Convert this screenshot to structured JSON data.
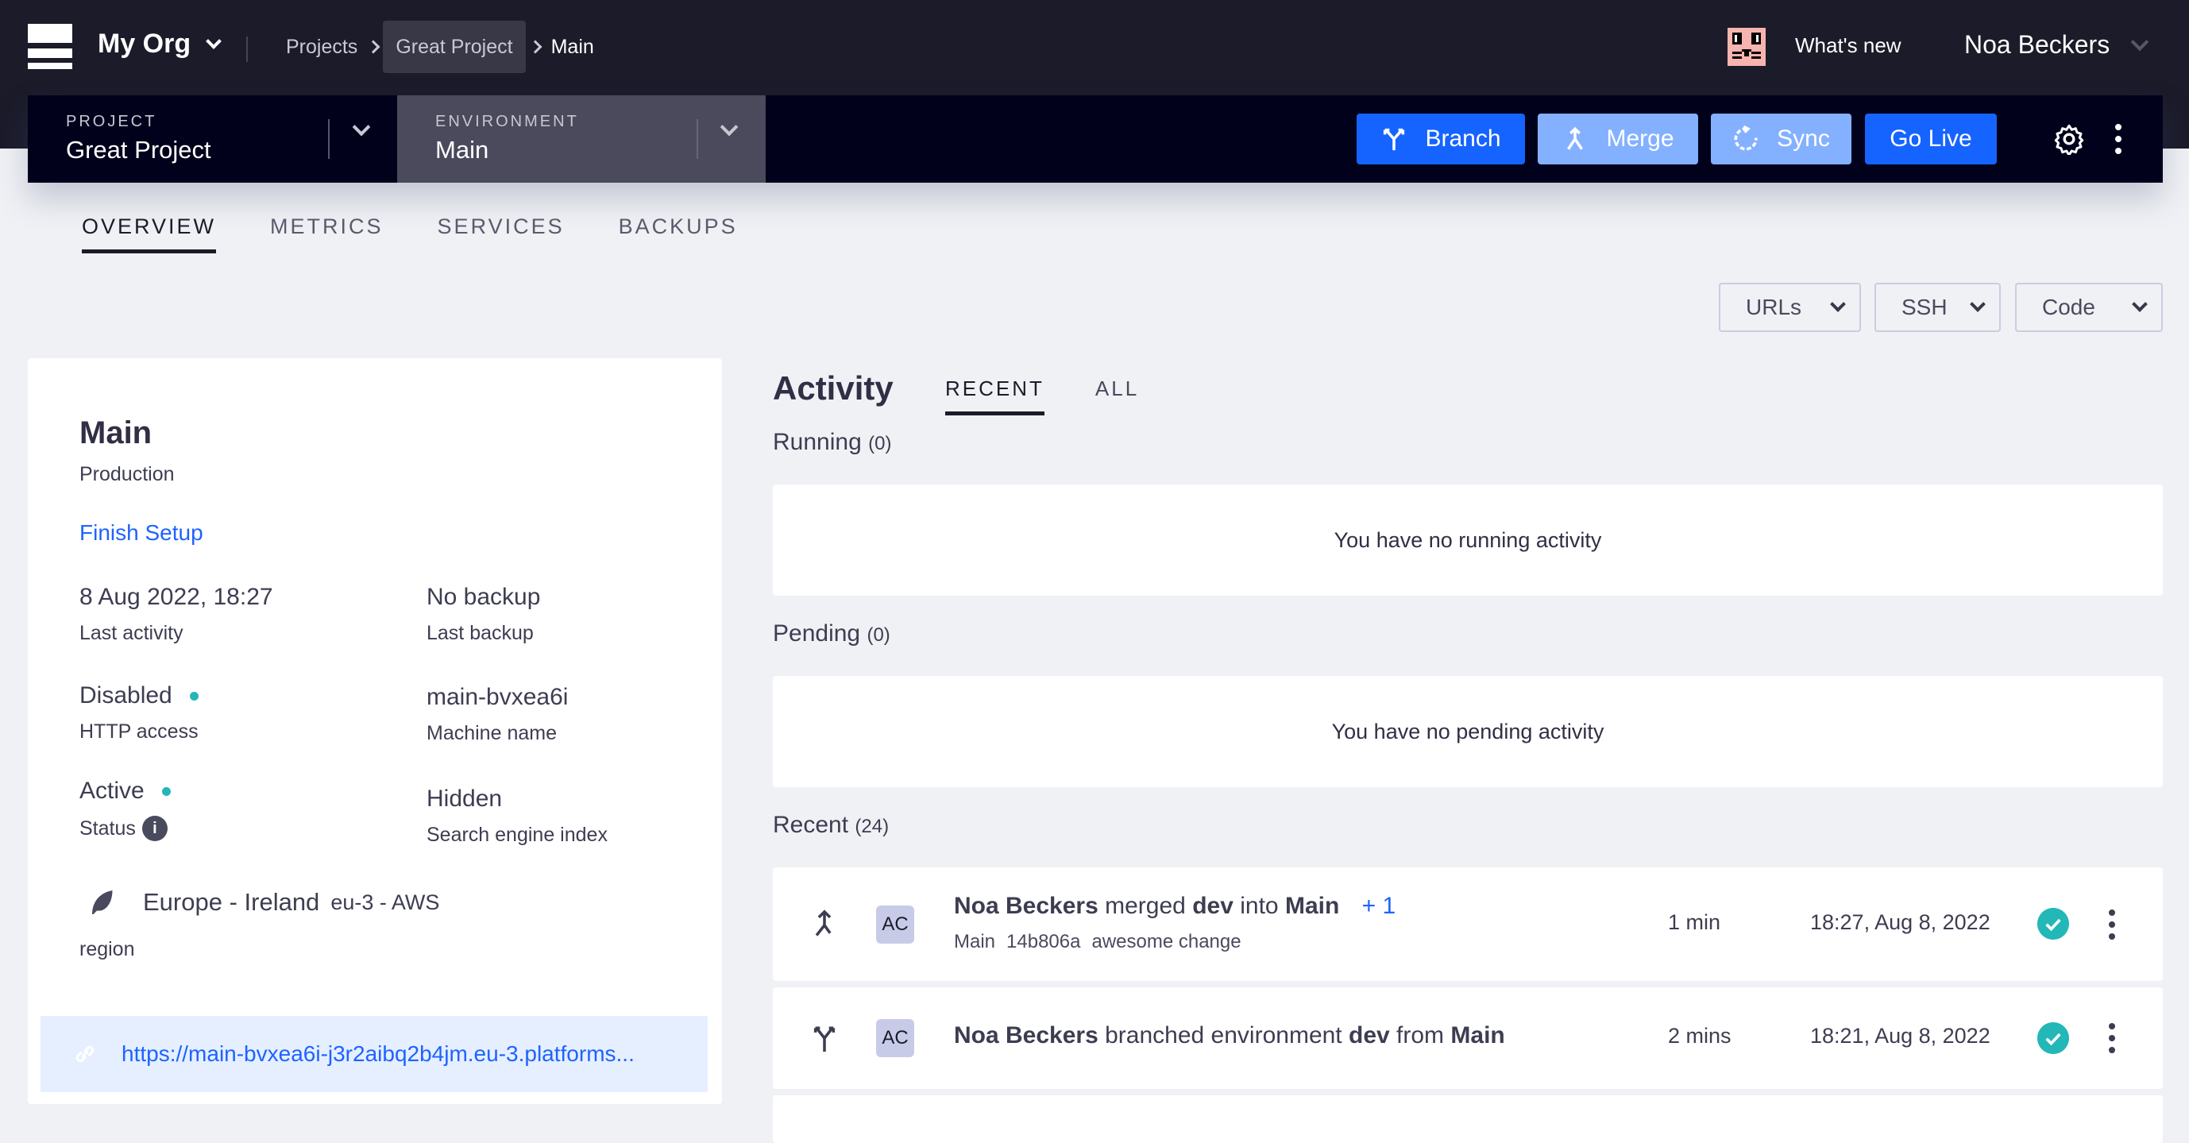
{
  "topnav": {
    "org": "My Org",
    "breadcrumbs": [
      "Projects",
      "Great Project",
      "Main"
    ],
    "whats_new": "What's new",
    "user": "Noa Beckers"
  },
  "project_bar": {
    "project_label": "PROJECT",
    "project_value": "Great Project",
    "environment_label": "ENVIRONMENT",
    "environment_value": "Main",
    "buttons": {
      "branch": "Branch",
      "merge": "Merge",
      "sync": "Sync",
      "go_live": "Go Live"
    },
    "colors": {
      "primary": "#1664ff",
      "disabled": "#84b1ff"
    }
  },
  "tabs": [
    "OVERVIEW",
    "METRICS",
    "SERVICES",
    "BACKUPS"
  ],
  "dropdowns": [
    "URLs",
    "SSH",
    "Code"
  ],
  "env_card": {
    "name": "Main",
    "type": "Production",
    "finish_setup": "Finish Setup",
    "last_activity_value": "8 Aug 2022, 18:27",
    "last_activity_label": "Last activity",
    "last_backup_value": "No backup",
    "last_backup_label": "Last backup",
    "http_value": "Disabled",
    "http_label": "HTTP access",
    "machine_value": "main-bvxea6i",
    "machine_label": "Machine name",
    "status_value": "Active",
    "status_label": "Status",
    "search_value": "Hidden",
    "search_label": "Search engine index",
    "region_value": "Europe - Ireland",
    "region_sub": "eu-3 - AWS",
    "region_label": "region",
    "url": "https://main-bvxea6i-j3r2aibq2b4jm.eu-3.platforms..."
  },
  "activity": {
    "title": "Activity",
    "tabs": [
      "RECENT",
      "ALL"
    ],
    "running_label": "Running",
    "running_count": "(0)",
    "running_empty": "You have no running activity",
    "pending_label": "Pending",
    "pending_count": "(0)",
    "pending_empty": "You have no pending activity",
    "recent_label": "Recent",
    "recent_count": "(24)",
    "items": [
      {
        "icon": "merge-icon",
        "avatar": "AC",
        "user": "Noa Beckers",
        "verb": "merged",
        "obj1": "dev",
        "prep": "into",
        "obj2": "Main",
        "extra": "+ 1",
        "sub": [
          "Main",
          "14b806a",
          "awesome change"
        ],
        "duration": "1 min",
        "time": "18:27, Aug 8, 2022",
        "status": "success"
      },
      {
        "icon": "branch-icon",
        "avatar": "AC",
        "user": "Noa Beckers",
        "verb": "branched environment",
        "obj1": "dev",
        "prep": "from",
        "obj2": "Main",
        "duration": "2 mins",
        "time": "18:21, Aug 8, 2022",
        "status": "success"
      }
    ]
  }
}
